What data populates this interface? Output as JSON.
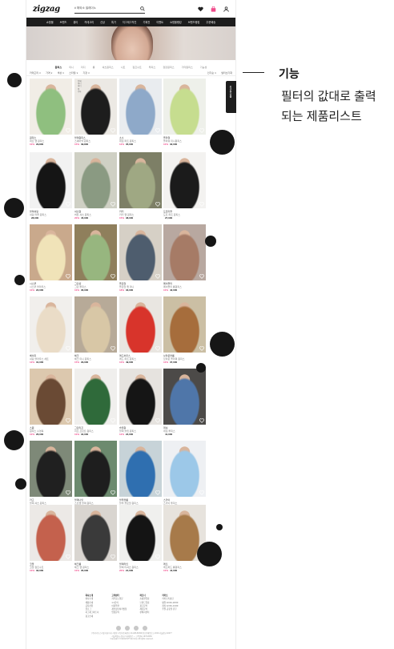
{
  "header": {
    "logo": "zigzag",
    "search_placeholder": "# 해외소 셀레이노",
    "icons": [
      "search-icon",
      "heart-icon",
      "bag-icon",
      "user-icon"
    ]
  },
  "gnb": [
    "쇼핑몰",
    "브랜드",
    "뷰티",
    "카테고리",
    "신상",
    "특가",
    "지그재그직진",
    "기획전",
    "이벤트",
    "쇼핑몰랭킹",
    "브랜드랭킹",
    "주문배송"
  ],
  "categories": [
    {
      "label": "원피스",
      "active": true
    },
    {
      "label": "미니",
      "active": false
    },
    {
      "label": "미디",
      "active": false
    },
    {
      "label": "롱",
      "active": false
    },
    {
      "label": "셔츠원피스",
      "active": false
    },
    {
      "label": "니트",
      "active": false
    },
    {
      "label": "점프수트",
      "active": false
    },
    {
      "label": "투피스",
      "active": false
    },
    {
      "label": "정장원피스",
      "active": false
    },
    {
      "label": "기타원피스",
      "active": false
    },
    {
      "label": "기능성",
      "active": false
    }
  ],
  "filters": {
    "left": [
      "카테고리 ∨",
      "가격 ∨",
      "색상 ∨",
      "스타일 ∨",
      "기장 ∨"
    ],
    "right": [
      "인기순 ∨",
      "필터초기화"
    ]
  },
  "dropdown_options": [
    "전체",
    "미니",
    "미디",
    "롱",
    "기타"
  ],
  "products": [
    {
      "shop": "원피스",
      "name": "퍼프 랩 원피스",
      "pct": "10%",
      "price": "29,800"
    },
    {
      "shop": "블랙원피스",
      "name": "스퀘어넥 원피스",
      "pct": "15%",
      "price": "39,800"
    },
    {
      "shop": "소소",
      "name": "데님 퍼프 원피스",
      "pct": "12%",
      "price": "35,000"
    },
    {
      "shop": "플라워",
      "name": "플라워 미니원피스",
      "pct": "10%",
      "price": "32,000"
    },
    {
      "shop": "블랙셔링",
      "name": "셔링 러플 원피스",
      "pct": "",
      "price": "28,000"
    },
    {
      "shop": "셔츠원",
      "name": "버튼 셔츠 원피스",
      "pct": "20%",
      "price": "45,000"
    },
    {
      "shop": "카키",
      "name": "카키 랩 원피스",
      "pct": "15%",
      "price": "38,000"
    },
    {
      "shop": "도트마을",
      "name": "도트 퍼프 원피스",
      "pct": "",
      "price": "27,000"
    },
    {
      "shop": "시스루",
      "name": "시스루 블라우스",
      "pct": "10%",
      "price": "22,000"
    },
    {
      "shop": "그린샵",
      "name": "그린 투피스",
      "pct": "10%",
      "price": "36,000"
    },
    {
      "shop": "플로럴",
      "name": "플로럴 랩 미니",
      "pct": "18%",
      "price": "33,000"
    },
    {
      "shop": "페이즐리",
      "name": "페이즐리 롱원피스",
      "pct": "10%",
      "price": "42,000"
    },
    {
      "shop": "베이지",
      "name": "셔링 블라우스 세트",
      "pct": "12%",
      "price": "31,000"
    },
    {
      "shop": "체크",
      "name": "체크 미니 원피스",
      "pct": "15%",
      "price": "29,000"
    },
    {
      "shop": "레드하우스",
      "name": "레드 퍼프 원피스",
      "pct": "10%",
      "price": "49,000"
    },
    {
      "shop": "브라운블룸",
      "name": "브라운 플라워 원피스",
      "pct": "10%",
      "price": "37,000"
    },
    {
      "shop": "스윔",
      "name": "원피스 수영복",
      "pct": "10%",
      "price": "26,000"
    },
    {
      "shop": "그린리프",
      "name": "리프 프린트 원피스",
      "pct": "10%",
      "price": "34,000"
    },
    {
      "shop": "슬립원",
      "name": "블랙 슬립 원피스",
      "pct": "12%",
      "price": "24,000"
    },
    {
      "shop": "데님",
      "name": "데님 투피스",
      "pct": "",
      "price": "41,000"
    },
    {
      "shop": "카고",
      "name": "블랙 셔츠 원피스",
      "pct": "10%",
      "price": "39,000"
    },
    {
      "shop": "블랙나잇",
      "name": "스트랩 블랙 원피스",
      "pct": "10%",
      "price": "30,000"
    },
    {
      "shop": "블루블룸",
      "name": "블루 플로럴 원피스",
      "pct": "15%",
      "price": "36,000"
    },
    {
      "shop": "스카이",
      "name": "스카이 투피스",
      "pct": "10%",
      "price": "33,000"
    },
    {
      "shop": "코랄",
      "name": "코랄 점프수트",
      "pct": "10%",
      "price": "32,000"
    },
    {
      "shop": "체크룸",
      "name": "체크 랩 원피스",
      "pct": "10%",
      "price": "35,000"
    },
    {
      "shop": "블랙라인",
      "name": "블랙 티셔츠 원피스",
      "pct": "20%",
      "price": "21,000"
    },
    {
      "shop": "레오",
      "name": "레오파드 롱원피스",
      "pct": "10%",
      "price": "44,000"
    }
  ],
  "footer": {
    "columns": [
      {
        "head": "회사소개",
        "items": [
          "회사소개",
          "채용안내",
          "공지사항",
          "블로그",
          "지그재그파트너",
          "광고안내"
        ]
      },
      {
        "head": "고객센터",
        "items": [
          "자주묻는질문",
          "1:1문의",
          "이용약관",
          "개인정보처리방침",
          "입점문의"
        ]
      },
      {
        "head": "파트너",
        "items": [
          "쇼핑몰입점",
          "브랜드입점",
          "광고문의",
          "제휴문의",
          "판매자센터"
        ]
      },
      {
        "head": "카카오",
        "items": [
          "카카오톡상담",
          "평일 10:00~18:00",
          "점심 12:00~13:00",
          "주말·공휴일 휴무"
        ]
      }
    ],
    "sns": [
      "instagram-icon",
      "youtube-icon",
      "facebook-icon",
      "blog-icon"
    ],
    "legal": [
      "(주)카카오스타일 대표이사 서정훈 사업자등록번호 214-88-81099 통신판매업신고 2013-서울강남-02277",
      "서울특별시 강남구 테헤란로 — 고객센터 1670-8050",
      "Copyright © KAKAOSTYLE Corp. All rights reserved."
    ]
  },
  "side_tab": "최근본상품",
  "annotation": {
    "title": "기능",
    "line1": "필터의 값대로 출력",
    "line2": "되는 제품리스트"
  }
}
